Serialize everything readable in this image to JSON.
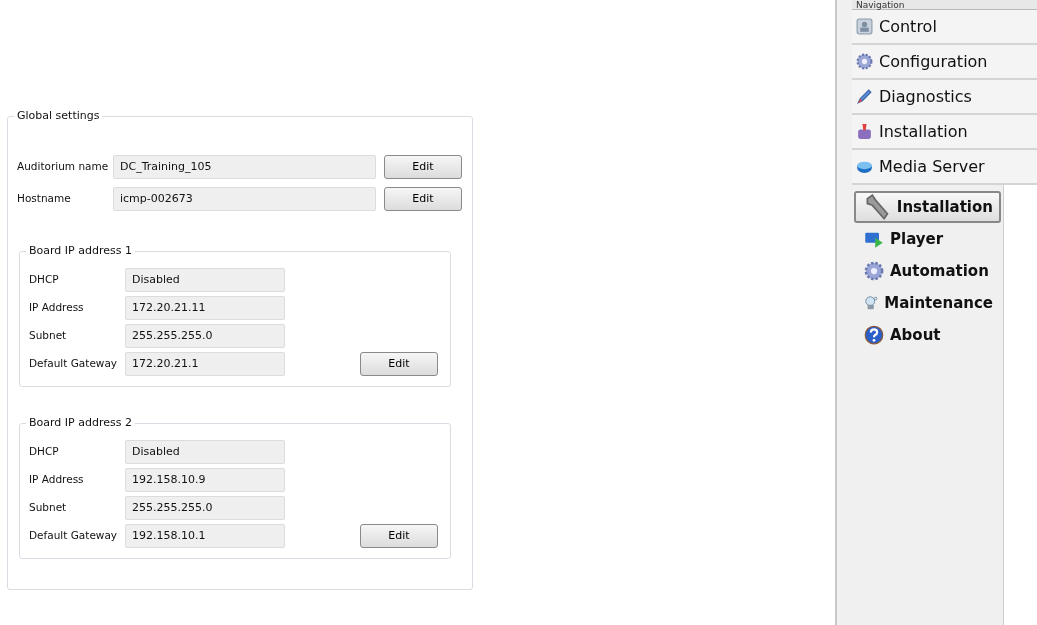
{
  "global_settings": {
    "title": "Global settings",
    "fields": [
      {
        "label": "Auditorium name",
        "value": "DC_Training_105",
        "button": "Edit"
      },
      {
        "label": "Hostname",
        "value": "icmp-002673",
        "button": "Edit"
      }
    ],
    "boards": [
      {
        "title": "Board IP address 1",
        "button": "Edit",
        "fields": [
          {
            "label": "DHCP",
            "value": "Disabled"
          },
          {
            "label": "IP Address",
            "value": "172.20.21.11"
          },
          {
            "label": "Subnet",
            "value": "255.255.255.0"
          },
          {
            "label": "Default Gateway",
            "value": "172.20.21.1"
          }
        ]
      },
      {
        "title": "Board IP address 2",
        "button": "Edit",
        "fields": [
          {
            "label": "DHCP",
            "value": "Disabled"
          },
          {
            "label": "IP Address",
            "value": "192.158.10.9"
          },
          {
            "label": "Subnet",
            "value": "255.255.255.0"
          },
          {
            "label": "Default Gateway",
            "value": "192.158.10.1"
          }
        ]
      }
    ]
  },
  "navigation": {
    "title": "Navigation",
    "sections": [
      {
        "label": "Control",
        "kind": "control"
      },
      {
        "label": "Configuration",
        "kind": "gear"
      },
      {
        "label": "Diagnostics",
        "kind": "pencil"
      },
      {
        "label": "Installation",
        "kind": "box"
      },
      {
        "label": "Media Server",
        "kind": "disk"
      }
    ],
    "items": [
      {
        "label": "Installation",
        "kind": "wrench",
        "selected": true
      },
      {
        "label": "Player",
        "kind": "player",
        "selected": false
      },
      {
        "label": "Automation",
        "kind": "gear",
        "selected": false
      },
      {
        "label": "Maintenance",
        "kind": "tool",
        "selected": false
      },
      {
        "label": "About",
        "kind": "help",
        "selected": false
      }
    ]
  }
}
